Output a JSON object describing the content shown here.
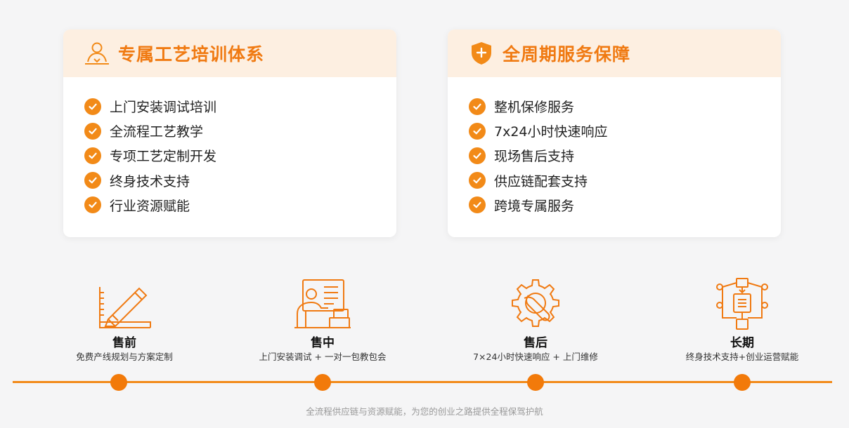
{
  "cards": [
    {
      "title": "专属工艺培训体系",
      "icon": "person-training-icon",
      "items": [
        "上门安装调试培训",
        "全流程工艺教学",
        "专项工艺定制开发",
        "终身技术支持",
        "行业资源赋能"
      ]
    },
    {
      "title": "全周期服务保障",
      "icon": "shield-plus-icon",
      "items": [
        "整机保修服务",
        "7x24小时快速响应",
        "现场售后支持",
        "供应链配套支持",
        "跨境专属服务"
      ]
    }
  ],
  "stages": [
    {
      "title": "售前",
      "subtitle": "免费产线规划与方案定制",
      "icon": "pencil-ruler-icon"
    },
    {
      "title": "售中",
      "subtitle": "上门安装调试 + 一对一包教包会",
      "icon": "teacher-board-icon"
    },
    {
      "title": "售后",
      "subtitle": "7×24小时快速响应 + 上门维修",
      "icon": "gear-wrench-icon"
    },
    {
      "title": "长期",
      "subtitle": "终身技术支持+创业运营赋能",
      "icon": "process-flow-icon"
    }
  ],
  "footer": "全流程供应链与资源赋能，为您的创业之路提供全程保驾护航",
  "colors": {
    "accent": "#f28a18",
    "title": "#f07a12",
    "card_head_bg": "#fdefe1",
    "background": "#f5f5f6"
  }
}
